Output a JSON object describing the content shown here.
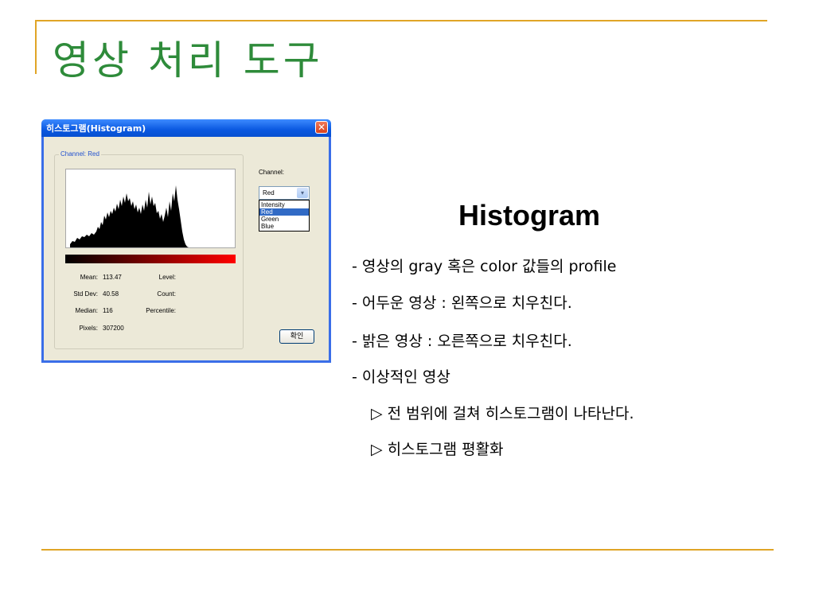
{
  "slide": {
    "title": "영상 처리 도구"
  },
  "dialog": {
    "title": "히스토그램(Histogram)",
    "close_glyph": "✕",
    "group_label": "Channel: Red",
    "channel_label": "Channel:",
    "select_value": "Red",
    "select_arrow": "▾",
    "dropdown_options": [
      "Intensity",
      "Red",
      "Green",
      "Blue"
    ],
    "dropdown_selected": "Red",
    "stats": {
      "mean_label": "Mean:",
      "mean_value": "113.47",
      "stddev_label": "Std Dev:",
      "stddev_value": "40.58",
      "median_label": "Median:",
      "median_value": "116",
      "pixels_label": "Pixels:",
      "pixels_value": "307200",
      "level_label": "Level:",
      "count_label": "Count:",
      "percentile_label": "Percentile:"
    },
    "ok_label": "확인",
    "colors": {
      "bar_start": "#000000",
      "bar_end": "#ff0000",
      "title_bar": "#0a58e0"
    }
  },
  "content": {
    "heading": "Histogram",
    "bullets": [
      "- 영상의 gray 혹은 color 값들의 profile",
      "- 어두운 영상 : 왼쪽으로 치우친다.",
      "- 밝은 영상 : 오른쪽으로 치우친다.",
      "- 이상적인 영상"
    ],
    "sub_bullets": [
      "▷ 전 범위에 걸쳐 히스토그램이 나타난다.",
      "▷ 히스토그램 평활화"
    ]
  },
  "colors": {
    "title": "#2e8b3a",
    "accent_line": "#e0a526"
  }
}
